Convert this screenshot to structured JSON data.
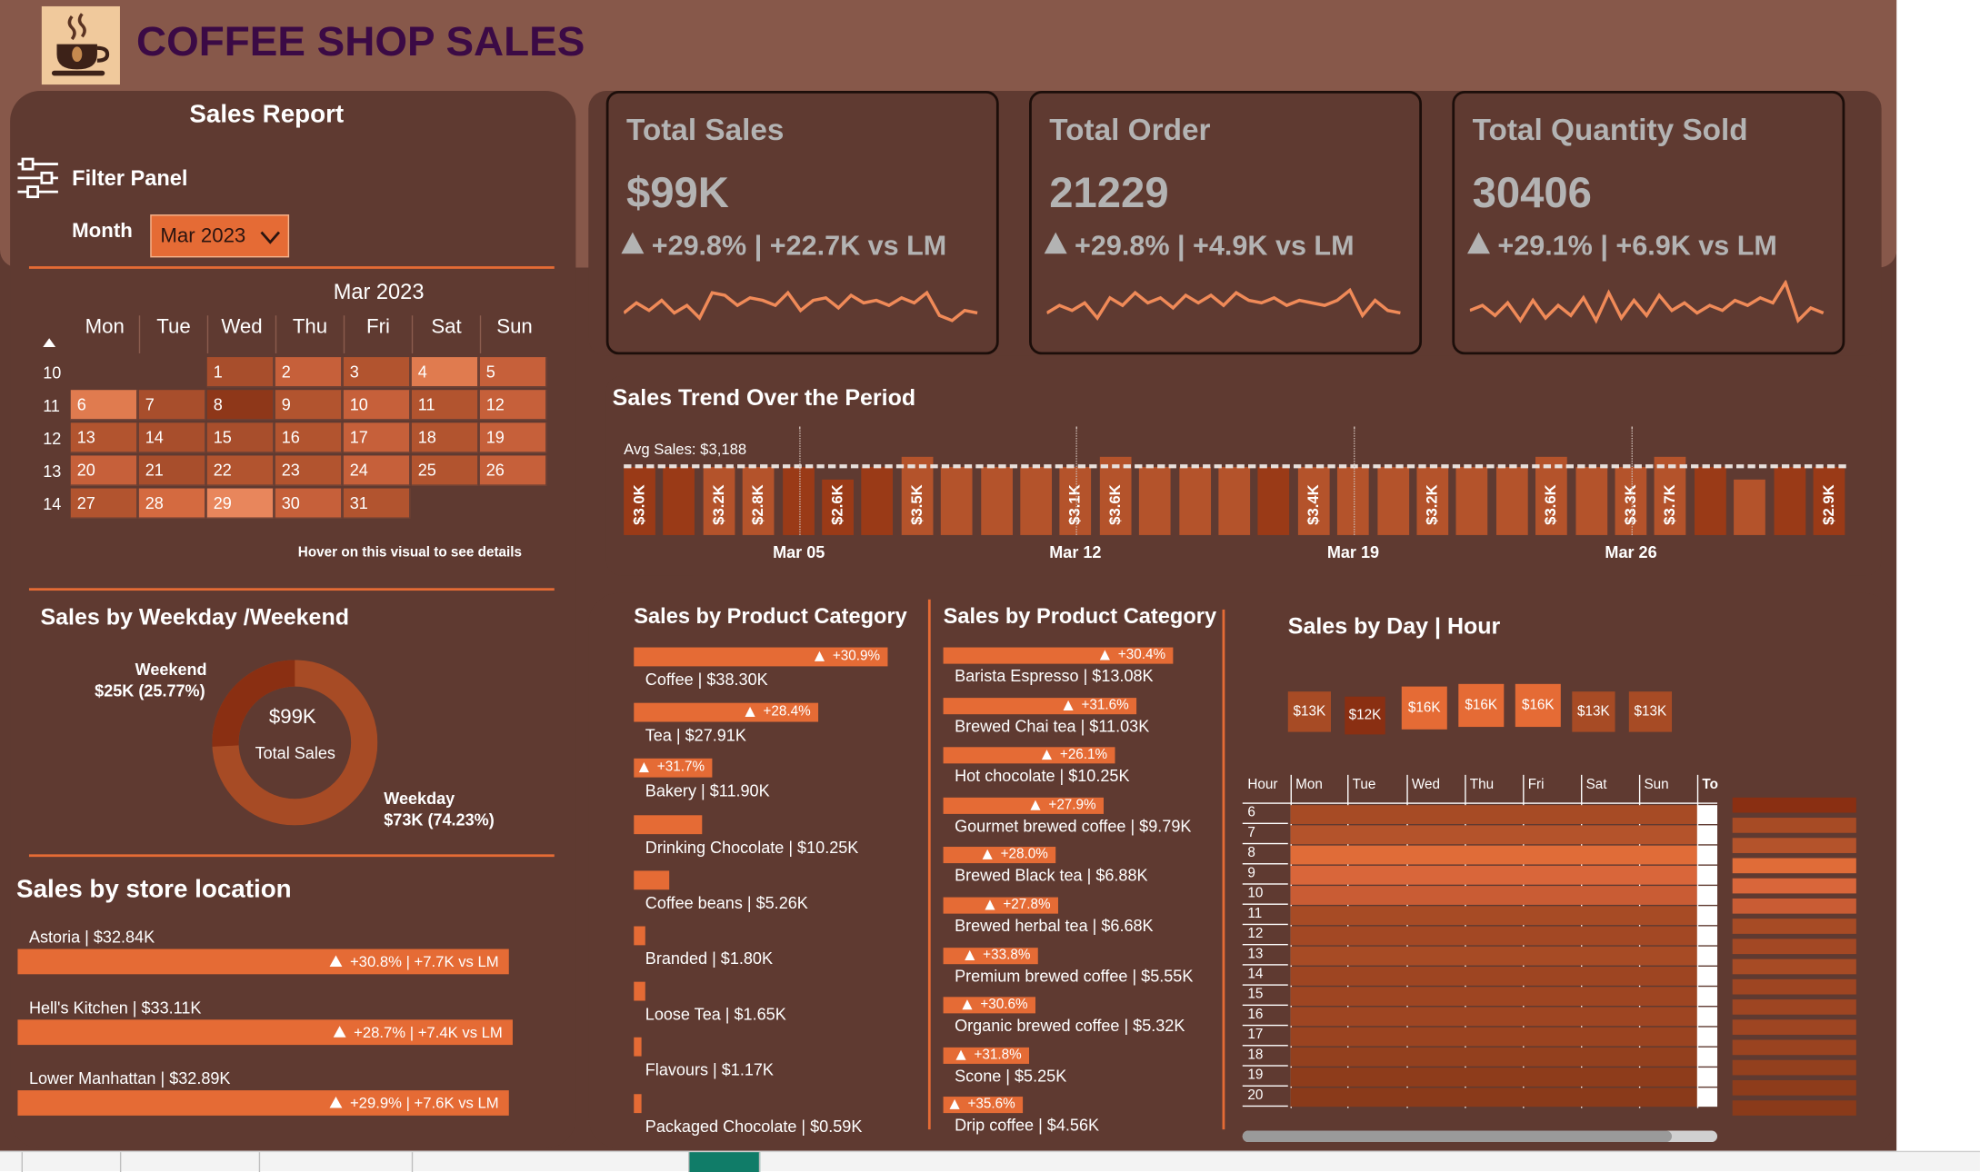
{
  "header": {
    "title": "COFFEE SHOP SALES",
    "logo_icon": "coffee-cup-icon"
  },
  "sales_report": {
    "title": "Sales Report",
    "filter_panel_label": "Filter Panel",
    "filter_icon": "sliders-icon",
    "month_label": "Month",
    "month_value": "Mar 2023",
    "hover_hint": "Hover on this visual to see details"
  },
  "calendar": {
    "title": "Mar 2023",
    "days": [
      "Mon",
      "Tue",
      "Wed",
      "Thu",
      "Fri",
      "Sat",
      "Sun"
    ],
    "weeks": [
      {
        "week": "10",
        "cells": [
          "",
          "",
          "1",
          "2",
          "3",
          "4",
          "5"
        ]
      },
      {
        "week": "11",
        "cells": [
          "6",
          "7",
          "8",
          "9",
          "10",
          "11",
          "12"
        ]
      },
      {
        "week": "12",
        "cells": [
          "13",
          "14",
          "15",
          "16",
          "17",
          "18",
          "19"
        ]
      },
      {
        "week": "13",
        "cells": [
          "20",
          "21",
          "22",
          "23",
          "24",
          "25",
          "26"
        ]
      },
      {
        "week": "14",
        "cells": [
          "27",
          "28",
          "29",
          "30",
          "31",
          "",
          ""
        ]
      }
    ]
  },
  "kpis": [
    {
      "title": "Total Sales",
      "value": "$99K",
      "delta": "+29.8% | +22.7K vs LM"
    },
    {
      "title": "Total Order",
      "value": "21229",
      "delta": "+29.8% | +4.9K vs LM"
    },
    {
      "title": "Total Quantity Sold",
      "value": "30406",
      "delta": "+29.1% | +6.9K vs LM"
    }
  ],
  "trend": {
    "title": "Sales Trend Over the Period",
    "avg_label": "Avg Sales: $3,188",
    "date_labels": [
      "Mar 05",
      "Mar 12",
      "Mar 19",
      "Mar 26"
    ],
    "bar_labels": [
      "$3.0K",
      "",
      "$3.2K",
      "$2.8K",
      "",
      "$2.6K",
      "",
      "$3.5K",
      "",
      "",
      "",
      "$3.1K",
      "$3.6K",
      "",
      "",
      "",
      "",
      "$3.4K",
      "",
      "",
      "$3.2K",
      "",
      "",
      "$3.6K",
      "",
      "$3.3K",
      "$3.7K",
      "",
      "",
      "",
      "$2.9K"
    ]
  },
  "weekday": {
    "title": "Sales by Weekday /Weekend",
    "center_value": "$99K",
    "center_label": "Total Sales",
    "weekend_label": "Weekend",
    "weekend_value": "$25K (25.77%)",
    "weekday_label": "Weekday",
    "weekday_value": "$73K (74.23%)"
  },
  "stores": {
    "title": "Sales by store location",
    "items": [
      {
        "label": "Astoria | $32.84K",
        "delta": "+30.8% | +7.7K vs LM"
      },
      {
        "label": "Hell's Kitchen | $33.11K",
        "delta": "+28.7% | +7.4K vs LM"
      },
      {
        "label": "Lower Manhattan | $32.89K",
        "delta": "+29.9% | +7.6K vs LM"
      }
    ]
  },
  "category1": {
    "title": "Sales by Product Category",
    "items": [
      {
        "label": "Coffee | $38.30K",
        "delta": "+30.9%"
      },
      {
        "label": "Tea | $27.91K",
        "delta": "+28.4%"
      },
      {
        "label": "Bakery | $11.90K",
        "delta": "+31.7%"
      },
      {
        "label": "Drinking Chocolate | $10.25K",
        "delta": ""
      },
      {
        "label": "Coffee beans | $5.26K",
        "delta": ""
      },
      {
        "label": "Branded | $1.80K",
        "delta": ""
      },
      {
        "label": "Loose Tea | $1.65K",
        "delta": ""
      },
      {
        "label": "Flavours | $1.17K",
        "delta": ""
      },
      {
        "label": "Packaged Chocolate | $0.59K",
        "delta": ""
      }
    ]
  },
  "category2": {
    "title": "Sales by Product Category",
    "items": [
      {
        "label": "Barista Espresso | $13.08K",
        "delta": "+30.4%"
      },
      {
        "label": "Brewed Chai tea | $11.03K",
        "delta": "+31.6%"
      },
      {
        "label": "Hot chocolate | $10.25K",
        "delta": "+26.1%"
      },
      {
        "label": "Gourmet brewed coffee | $9.79K",
        "delta": "+27.9%"
      },
      {
        "label": "Brewed Black tea | $6.88K",
        "delta": "+28.0%"
      },
      {
        "label": "Brewed herbal tea | $6.68K",
        "delta": "+27.8%"
      },
      {
        "label": "Premium brewed coffee | $5.55K",
        "delta": "+33.8%"
      },
      {
        "label": "Organic brewed coffee | $5.32K",
        "delta": "+30.6%"
      },
      {
        "label": "Scone | $5.25K",
        "delta": "+31.8%"
      },
      {
        "label": "Drip coffee | $4.56K",
        "delta": "+35.6%"
      }
    ]
  },
  "dayhour": {
    "title": "Sales by Day | Hour",
    "day_values": [
      "$13K",
      "$12K",
      "$16K",
      "$16K",
      "$16K",
      "$13K",
      "$13K"
    ],
    "columns": [
      "Hour",
      "Mon",
      "Tue",
      "Wed",
      "Thu",
      "Fri",
      "Sat",
      "Sun",
      "To"
    ],
    "hours": [
      "6",
      "7",
      "8",
      "9",
      "10",
      "11",
      "12",
      "13",
      "14",
      "15",
      "16",
      "17",
      "18",
      "19",
      "20"
    ]
  },
  "colors": {
    "accent": "#e56b35",
    "bg": "#5f3a31",
    "band": "#87584a",
    "title": "#3b0a45"
  }
}
